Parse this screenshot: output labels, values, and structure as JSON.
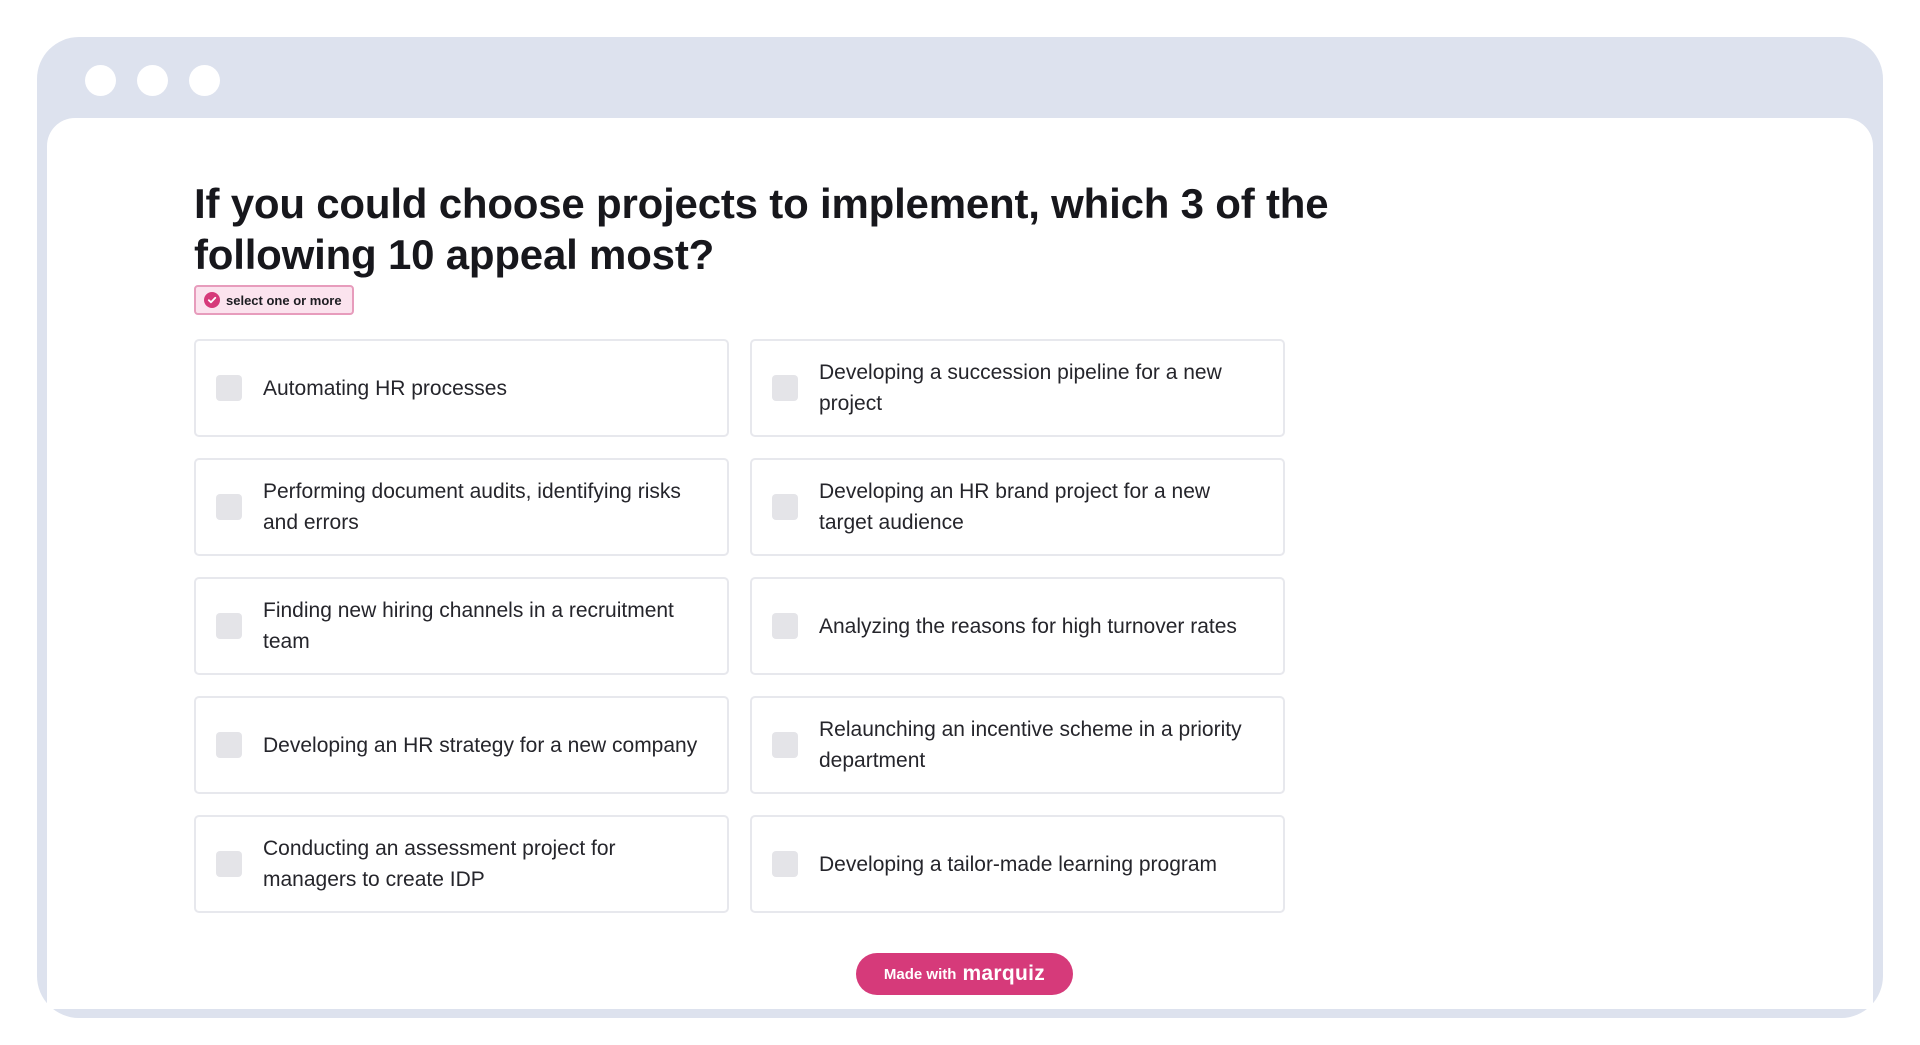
{
  "window": {
    "controls": [
      "dot",
      "dot",
      "dot"
    ]
  },
  "quiz": {
    "question": "If you could choose projects to implement, which 3 of the following 10 appeal most?",
    "hint": "select one or more",
    "hint_icon": "check-circle-icon",
    "options": [
      {
        "label": "Automating HR processes",
        "checked": false
      },
      {
        "label": "Developing a succession pipeline for a new project",
        "checked": false
      },
      {
        "label": "Performing document audits, identifying risks and errors",
        "checked": false
      },
      {
        "label": "Developing an HR brand project for a new target audience",
        "checked": false
      },
      {
        "label": "Finding new hiring channels in a recruitment team",
        "checked": false
      },
      {
        "label": "Analyzing the reasons for high turnover rates",
        "checked": false
      },
      {
        "label": "Developing an HR strategy for a new company",
        "checked": false
      },
      {
        "label": "Relaunching an incentive scheme in a priority department",
        "checked": false
      },
      {
        "label": "Conducting an assessment project for managers to create IDP",
        "checked": false
      },
      {
        "label": "Developing a tailor-made learning program",
        "checked": false
      }
    ]
  },
  "footer": {
    "made_with": "Made with",
    "brand": "marquiz"
  },
  "colors": {
    "accent": "#d63a7a",
    "hint_bg": "#fbe3ee",
    "frame": "#dde2ee",
    "checkbox": "#e4e4e8",
    "option_border": "#e7e8ed"
  }
}
